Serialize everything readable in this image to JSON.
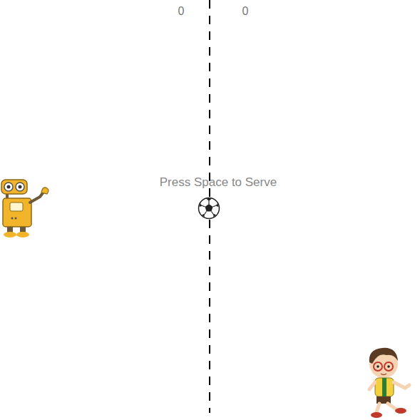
{
  "scores": [
    "0",
    "0"
  ],
  "message": "Press Space to Serve"
}
